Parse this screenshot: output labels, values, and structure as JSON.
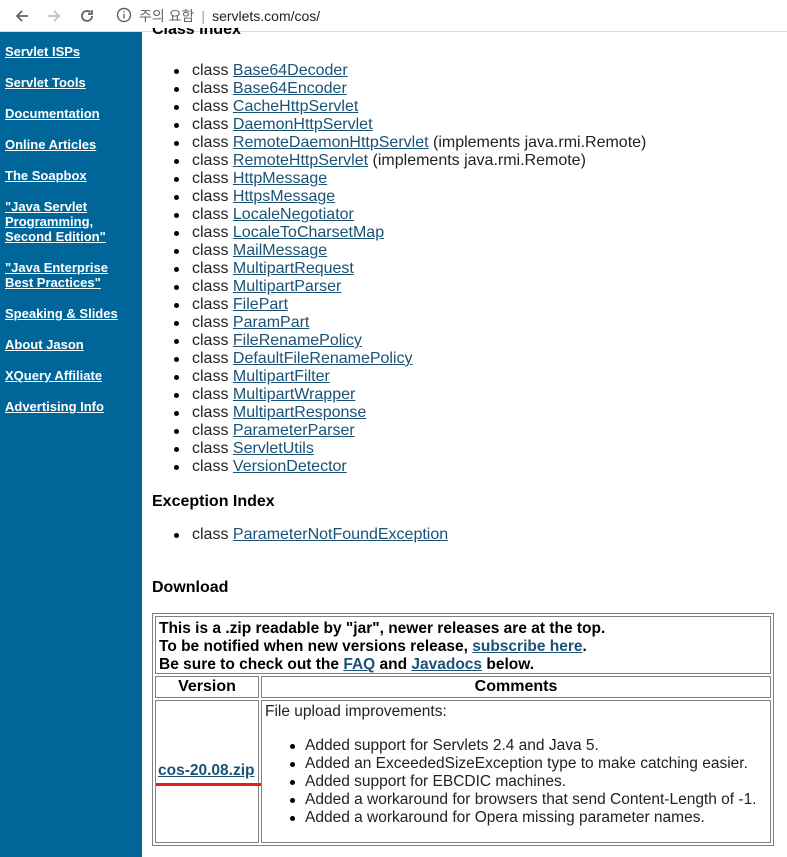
{
  "browser": {
    "security_label": "주의 요함",
    "url": "servlets.com/cos/"
  },
  "sidebar": {
    "items": [
      {
        "label": "Servlet ISPs"
      },
      {
        "label": "Servlet Tools"
      },
      {
        "label": "Documentation"
      },
      {
        "label": "Online Articles"
      },
      {
        "label": "The Soapbox"
      },
      {
        "label": "\"Java Servlet Programming, Second Edition\""
      },
      {
        "label": "\"Java Enterprise Best Practices\""
      },
      {
        "label": "Speaking & Slides"
      },
      {
        "label": "About Jason"
      },
      {
        "label": "XQuery Affiliate"
      },
      {
        "label": "Advertising Info"
      }
    ]
  },
  "class_index": {
    "title": "Class Index",
    "prefix": "class",
    "items": [
      {
        "name": "Base64Decoder",
        "suffix": ""
      },
      {
        "name": "Base64Encoder",
        "suffix": ""
      },
      {
        "name": "CacheHttpServlet",
        "suffix": ""
      },
      {
        "name": "DaemonHttpServlet",
        "suffix": ""
      },
      {
        "name": "RemoteDaemonHttpServlet",
        "suffix": " (implements java.rmi.Remote)"
      },
      {
        "name": "RemoteHttpServlet",
        "suffix": " (implements java.rmi.Remote)"
      },
      {
        "name": "HttpMessage",
        "suffix": ""
      },
      {
        "name": "HttpsMessage",
        "suffix": ""
      },
      {
        "name": "LocaleNegotiator",
        "suffix": ""
      },
      {
        "name": "LocaleToCharsetMap",
        "suffix": ""
      },
      {
        "name": "MailMessage",
        "suffix": ""
      },
      {
        "name": "MultipartRequest",
        "suffix": ""
      },
      {
        "name": "MultipartParser",
        "suffix": ""
      },
      {
        "name": "FilePart",
        "suffix": ""
      },
      {
        "name": "ParamPart",
        "suffix": ""
      },
      {
        "name": "FileRenamePolicy",
        "suffix": ""
      },
      {
        "name": "DefaultFileRenamePolicy",
        "suffix": ""
      },
      {
        "name": "MultipartFilter",
        "suffix": ""
      },
      {
        "name": "MultipartWrapper",
        "suffix": ""
      },
      {
        "name": "MultipartResponse",
        "suffix": ""
      },
      {
        "name": "ParameterParser",
        "suffix": ""
      },
      {
        "name": "ServletUtils",
        "suffix": ""
      },
      {
        "name": "VersionDetector",
        "suffix": ""
      }
    ]
  },
  "exception_index": {
    "title": "Exception Index",
    "prefix": "class",
    "items": [
      {
        "name": "ParameterNotFoundException",
        "suffix": ""
      }
    ]
  },
  "download": {
    "title": "Download",
    "notice_line1": "This is a .zip readable by \"jar\", newer releases are at the top.",
    "notice_line2_pre": "To be notified when new versions release, ",
    "notice_line2_link": "subscribe here",
    "notice_line2_post": ".",
    "notice_line3_pre": "Be sure to check out the ",
    "notice_line3_link1": "FAQ",
    "notice_line3_mid": " and ",
    "notice_line3_link2": "Javadocs",
    "notice_line3_post": " below.",
    "col_version": "Version",
    "col_comments": "Comments",
    "release": {
      "file": "cos-20.08.zip",
      "summary": "File upload improvements:",
      "changes": [
        "Added support for Servlets 2.4 and Java 5.",
        "Added an ExceededSizeException type to make catching easier.",
        "Added support for EBCDIC machines.",
        "Added a workaround for browsers that send Content-Length of -1.",
        "Added a workaround for Opera missing parameter names."
      ]
    }
  },
  "colors": {
    "sidebar_bg": "#006699",
    "link": "#1a5276",
    "highlight": "#e02020"
  }
}
